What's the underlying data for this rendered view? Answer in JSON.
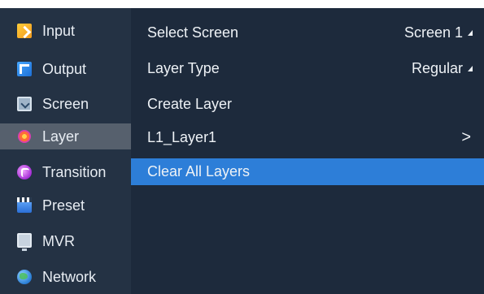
{
  "sidebar": {
    "items": [
      {
        "label": "Input",
        "icon": "input-icon"
      },
      {
        "label": "Output",
        "icon": "output-icon"
      },
      {
        "label": "Screen",
        "icon": "screen-icon"
      },
      {
        "label": "Layer",
        "icon": "layer-icon",
        "selected": true
      },
      {
        "label": "Transition",
        "icon": "transition-icon"
      },
      {
        "label": "Preset",
        "icon": "preset-icon"
      },
      {
        "label": "MVR",
        "icon": "mvr-icon"
      },
      {
        "label": "Network",
        "icon": "network-icon"
      }
    ]
  },
  "panel": {
    "select_screen": {
      "label": "Select Screen",
      "value": "Screen 1"
    },
    "layer_type": {
      "label": "Layer Type",
      "value": "Regular"
    },
    "create_layer": {
      "label": "Create Layer"
    },
    "layer1": {
      "label": "L1_Layer1",
      "arrow": ">"
    },
    "clear_all": {
      "label": "Clear All Layers"
    }
  },
  "colors": {
    "background": "#1d2a3c",
    "sidebar": "#243244",
    "selected": "#56606d",
    "highlight": "#2d7ed8"
  }
}
